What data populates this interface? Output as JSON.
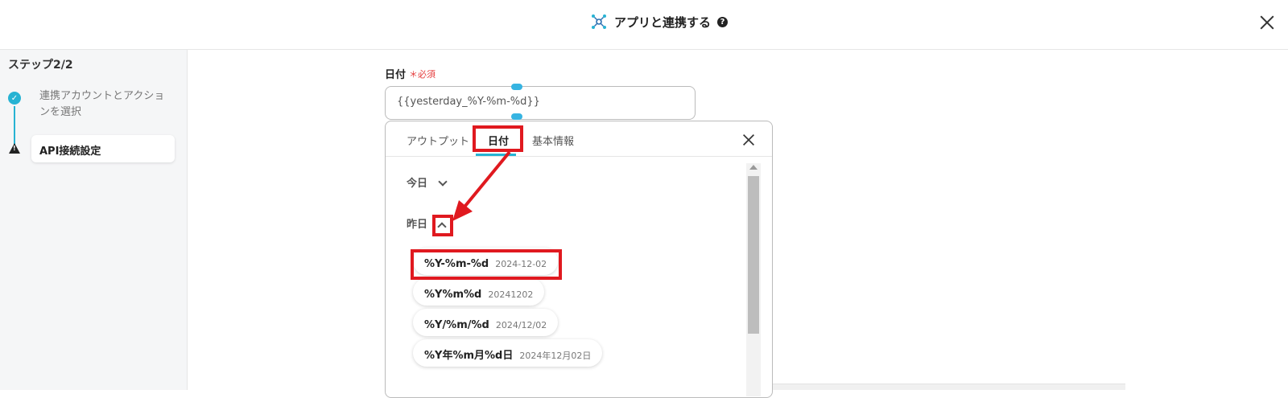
{
  "header": {
    "title": "アプリと連携する",
    "help_icon": "?"
  },
  "sidebar": {
    "step_title": "ステップ2/2",
    "steps": [
      {
        "label": "連携アカウントとアクションを選択",
        "status": "done"
      },
      {
        "label": "API接続設定",
        "status": "warning"
      }
    ]
  },
  "field": {
    "label": "日付",
    "required_label": "＊必須",
    "value": "{{yesterday_%Y-%m-%d}}"
  },
  "popup": {
    "tabs": [
      {
        "label": "アウトプット"
      },
      {
        "label": "日付",
        "active": true
      },
      {
        "label": "基本情報"
      }
    ],
    "groups": [
      {
        "label": "今日",
        "expanded": false
      },
      {
        "label": "昨日",
        "expanded": true
      }
    ],
    "options": [
      {
        "format": "%Y-%m-%d",
        "example": "2024-12-02"
      },
      {
        "format": "%Y%m%d",
        "example": "20241202"
      },
      {
        "format": "%Y/%m/%d",
        "example": "2024/12/02"
      },
      {
        "format": "%Y年%m月%d日",
        "example": "2024年12月02日"
      }
    ]
  },
  "colors": {
    "accent": "#27b3d3",
    "highlight": "#e0191f",
    "required": "#e53d3d"
  }
}
